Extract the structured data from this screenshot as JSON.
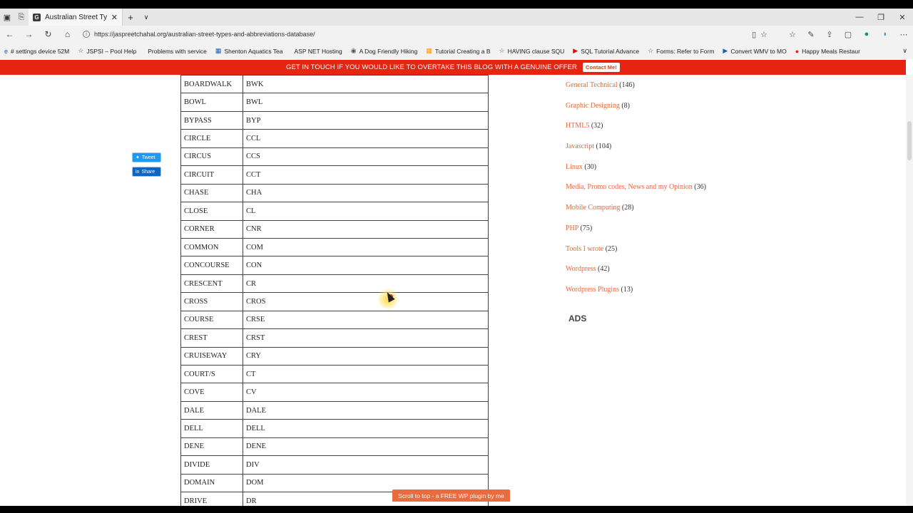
{
  "browser": {
    "tab_title": "Australian Street Types",
    "url": "https://jaspreetchahal.org/australian-street-types-and-abbreviations-database/",
    "favorites": [
      {
        "label": "# settings device 52M",
        "icon": "edge-icon"
      },
      {
        "label": "JSPSI – Pool Help",
        "icon": "star-icon"
      },
      {
        "label": "Problems with service",
        "icon": "page-icon"
      },
      {
        "label": "Shenton Aquatics Tea",
        "icon": "grid-icon"
      },
      {
        "label": "ASP NET Hosting",
        "icon": "page-icon"
      },
      {
        "label": "A Dog Friendly Hiking",
        "icon": "page-icon"
      },
      {
        "label": "Tutorial Creating a B",
        "icon": "ms-icon"
      },
      {
        "label": "HAVING clause SQU",
        "icon": "star-icon"
      },
      {
        "label": "SQL Tutorial Advance",
        "icon": "youtube-icon"
      },
      {
        "label": "Forms: Refer to Form",
        "icon": "star-icon"
      },
      {
        "label": "Convert WMV to MO",
        "icon": "play-icon"
      },
      {
        "label": "Happy Meals Restaur",
        "icon": "record-icon"
      }
    ]
  },
  "banner": {
    "text": "GET IN TOUCH IF YOU WOULD LIKE TO OVERTAKE THIS BLOG WITH A GENUINE OFFER",
    "button": "Contact Me!"
  },
  "social": {
    "tweet": "Tweet",
    "share": "Share"
  },
  "street_types": [
    [
      "BOARDWALK",
      "BWK"
    ],
    [
      "BOWL",
      "BWL"
    ],
    [
      "BYPASS",
      "BYP"
    ],
    [
      "CIRCLE",
      "CCL"
    ],
    [
      "CIRCUS",
      "CCS"
    ],
    [
      "CIRCUIT",
      "CCT"
    ],
    [
      "CHASE",
      "CHA"
    ],
    [
      "CLOSE",
      "CL"
    ],
    [
      "CORNER",
      "CNR"
    ],
    [
      "COMMON",
      "COM"
    ],
    [
      "CONCOURSE",
      "CON"
    ],
    [
      "CRESCENT",
      "CR"
    ],
    [
      "CROSS",
      "CROS"
    ],
    [
      "COURSE",
      "CRSE"
    ],
    [
      "CREST",
      "CRST"
    ],
    [
      "CRUISEWAY",
      "CRY"
    ],
    [
      "COURT/S",
      "CT"
    ],
    [
      "COVE",
      "CV"
    ],
    [
      "DALE",
      "DALE"
    ],
    [
      "DELL",
      "DELL"
    ],
    [
      "DENE",
      "DENE"
    ],
    [
      "DIVIDE",
      "DIV"
    ],
    [
      "DOMAIN",
      "DOM"
    ],
    [
      "DRIVE",
      "DR"
    ]
  ],
  "categories": [
    {
      "name": "General Technical",
      "count": "(146)"
    },
    {
      "name": "Graphic Designing",
      "count": "(8)"
    },
    {
      "name": "HTML5",
      "count": "(32)"
    },
    {
      "name": "Javascript",
      "count": "(104)"
    },
    {
      "name": "Linux",
      "count": "(30)"
    },
    {
      "name": "Media, Promo codes, News and my Opinion",
      "count": "(36)"
    },
    {
      "name": "Mobile Computing",
      "count": "(28)"
    },
    {
      "name": "PHP",
      "count": "(75)"
    },
    {
      "name": "Tools I wrote",
      "count": "(25)"
    },
    {
      "name": "Wordpress",
      "count": "(42)"
    },
    {
      "name": "Wordpress Plugins",
      "count": "(13)"
    }
  ],
  "ads_heading": "ADS",
  "scroll_top_label": "Scroll to top - a FREE WP plugin by me",
  "colors": {
    "banner": "#e52412",
    "category_link": "#e3683d",
    "scroll_top": "#ea6b3d"
  }
}
